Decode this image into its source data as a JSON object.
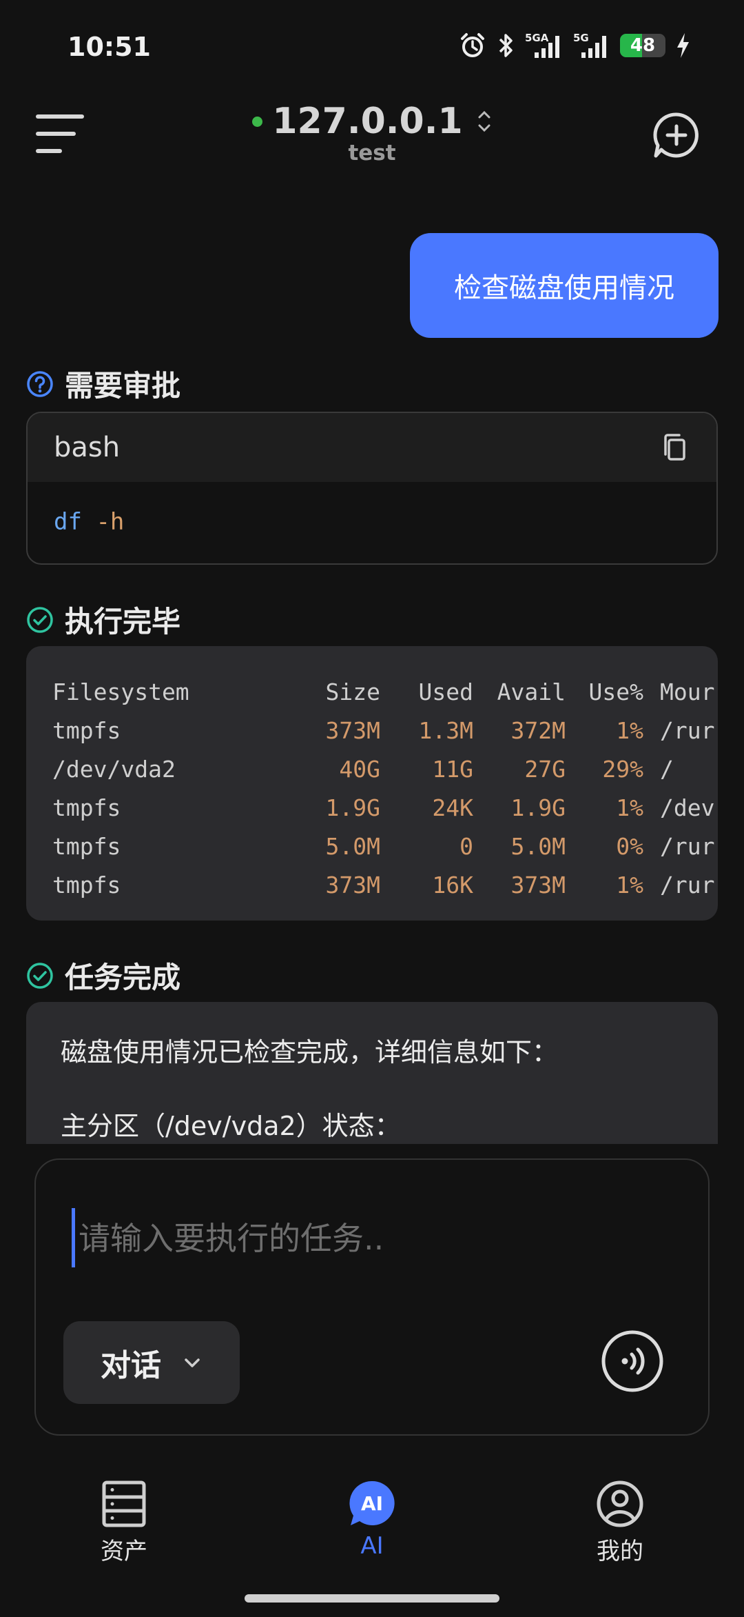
{
  "status_bar": {
    "time": "10:51",
    "signal1_label": "5GA",
    "signal2_label": "5G",
    "battery": "48",
    "battery_level": 0.48
  },
  "header": {
    "host": "127.0.0.1",
    "host_name": "test",
    "status_color": "#3cb84a"
  },
  "user_message": "检查磁盘使用情况",
  "approval": {
    "title": "需要审批",
    "code_lang": "bash",
    "command": "df",
    "command_args": "-h"
  },
  "execution": {
    "title": "执行完毕",
    "headers": [
      "Filesystem",
      "Size",
      "Used",
      "Avail",
      "Use%",
      "Mour"
    ],
    "rows": [
      [
        "tmpfs",
        "373M",
        "1.3M",
        "372M",
        "1%",
        "/rur"
      ],
      [
        "/dev/vda2",
        "40G",
        "11G",
        "27G",
        "29%",
        "/"
      ],
      [
        "tmpfs",
        "1.9G",
        "24K",
        "1.9G",
        "1%",
        "/dev"
      ],
      [
        "tmpfs",
        "5.0M",
        "0",
        "5.0M",
        "0%",
        "/rur"
      ],
      [
        "tmpfs",
        "373M",
        "16K",
        "373M",
        "1%",
        "/rur"
      ]
    ]
  },
  "task_done": {
    "title": "任务完成",
    "line1": "磁盘使用情况已检查完成，详细信息如下：",
    "line2": "主分区（/dev/vda2）状态："
  },
  "input": {
    "placeholder": "请输入要执行的任务..",
    "mode_label": "对话"
  },
  "nav": {
    "assets": "资产",
    "ai": "AI",
    "ai_icon_text": "AI",
    "mine": "我的",
    "active_color": "#4a78ff"
  }
}
